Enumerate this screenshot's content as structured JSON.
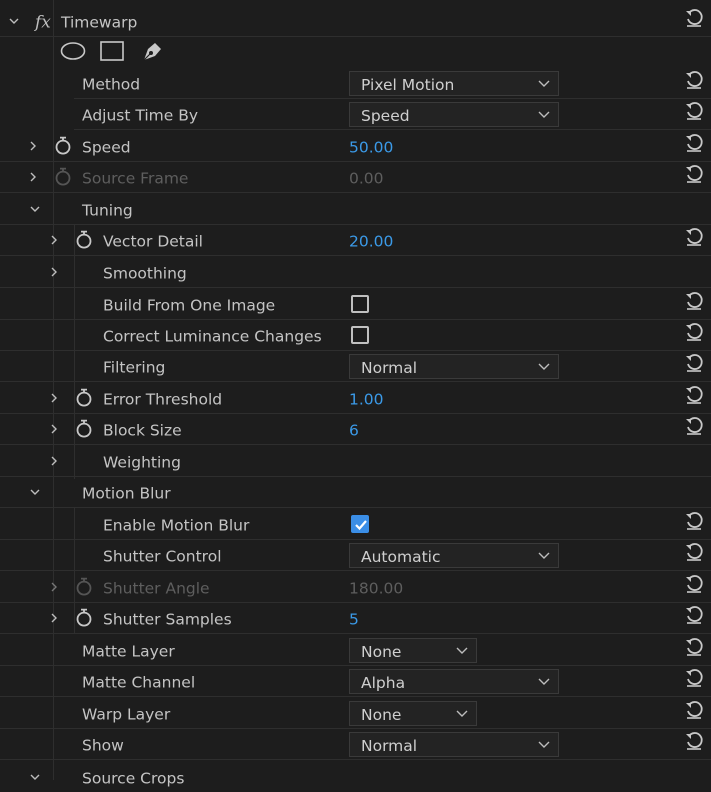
{
  "effect": {
    "fx": "fx",
    "title": "Timewarp"
  },
  "mask_tools": [
    "ellipse-mask-icon",
    "rectangle-mask-icon",
    "pen-mask-icon"
  ],
  "rows": {
    "method": {
      "label": "Method",
      "value": "Pixel Motion"
    },
    "adjust_time_by": {
      "label": "Adjust Time By",
      "value": "Speed"
    },
    "speed": {
      "label": "Speed",
      "value": "50.00"
    },
    "source_frame": {
      "label": "Source Frame",
      "value": "0.00"
    },
    "tuning": {
      "label": "Tuning"
    },
    "vector_detail": {
      "label": "Vector Detail",
      "value": "20.00"
    },
    "smoothing": {
      "label": "Smoothing"
    },
    "build_from_one_image": {
      "label": "Build From One Image",
      "checked": false
    },
    "correct_luminance": {
      "label": "Correct Luminance Changes",
      "checked": false
    },
    "filtering": {
      "label": "Filtering",
      "value": "Normal"
    },
    "error_threshold": {
      "label": "Error Threshold",
      "value": "1.00"
    },
    "block_size": {
      "label": "Block Size",
      "value": "6"
    },
    "weighting": {
      "label": "Weighting"
    },
    "motion_blur": {
      "label": "Motion Blur"
    },
    "enable_motion_blur": {
      "label": "Enable Motion Blur",
      "checked": true
    },
    "shutter_control": {
      "label": "Shutter Control",
      "value": "Automatic"
    },
    "shutter_angle": {
      "label": "Shutter Angle",
      "value": "180.00"
    },
    "shutter_samples": {
      "label": "Shutter Samples",
      "value": "5"
    },
    "matte_layer": {
      "label": "Matte Layer",
      "value": "None"
    },
    "matte_channel": {
      "label": "Matte Channel",
      "value": "Alpha"
    },
    "warp_layer": {
      "label": "Warp Layer",
      "value": "None"
    },
    "show": {
      "label": "Show",
      "value": "Normal"
    },
    "source_crops": {
      "label": "Source Crops"
    }
  },
  "colors": {
    "accent": "#3b9ae8",
    "background": "#1d1d1d",
    "disabled": "#5e5e5e"
  }
}
